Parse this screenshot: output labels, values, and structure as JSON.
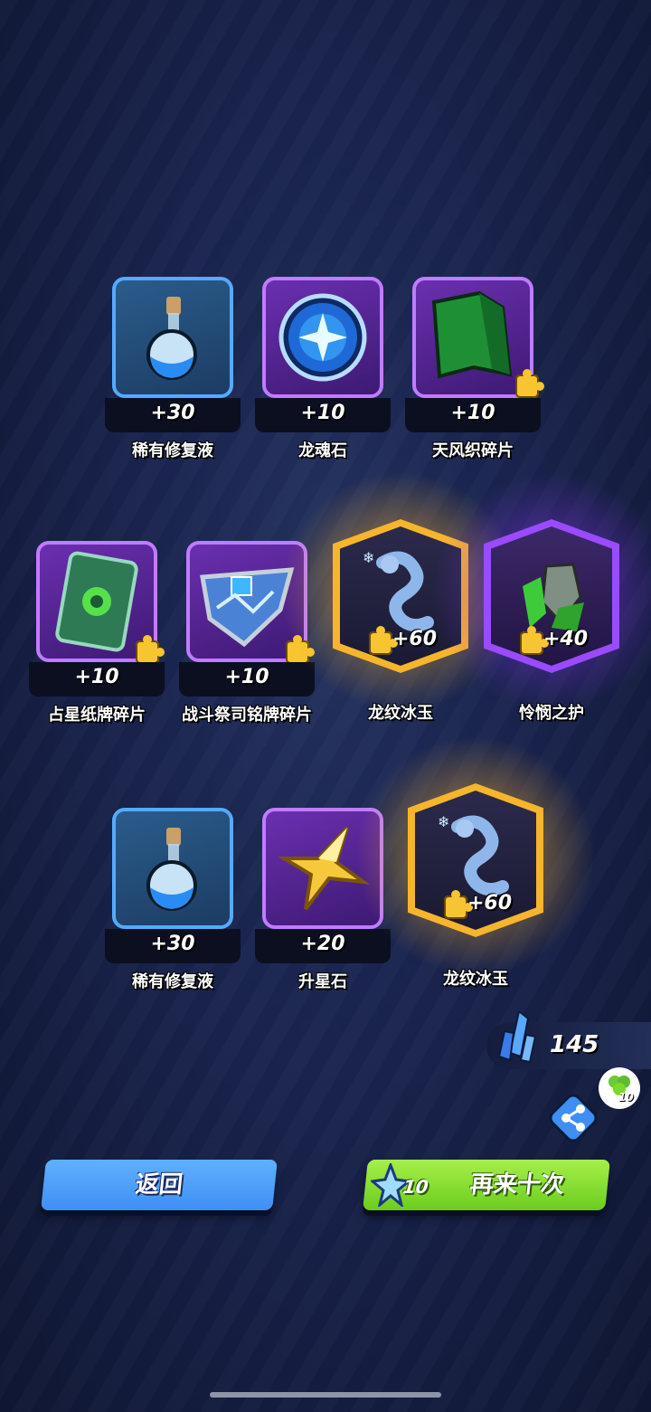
{
  "rewards": [
    {
      "name": "稀有修复液",
      "qty": "+30",
      "rarity": "blue",
      "icon": "potion-icon"
    },
    {
      "name": "龙魂石",
      "qty": "+10",
      "rarity": "purple",
      "icon": "soul-orb-icon"
    },
    {
      "name": "天风织碎片",
      "qty": "+10",
      "rarity": "purple",
      "icon": "cape-icon",
      "fragment": true
    },
    {
      "name": "占星纸牌碎片",
      "qty": "+10",
      "rarity": "purple",
      "icon": "tarot-card-icon",
      "fragment": true
    },
    {
      "name": "战斗祭司铭牌碎片",
      "qty": "+10",
      "rarity": "purple",
      "icon": "ice-badge-icon",
      "fragment": true
    },
    {
      "name": "龙纹冰玉",
      "qty": "+60",
      "rarity": "legendary-gold",
      "icon": "ice-dragon-icon",
      "fragment": true
    },
    {
      "name": "怜悯之护",
      "qty": "+40",
      "rarity": "epic-purple",
      "icon": "green-crystal-shield-icon",
      "fragment": true
    },
    {
      "name": "稀有修复液",
      "qty": "+30",
      "rarity": "blue",
      "icon": "potion-icon"
    },
    {
      "name": "升星石",
      "qty": "+20",
      "rarity": "purple",
      "icon": "gold-star-icon"
    },
    {
      "name": "龙纹冰玉",
      "qty": "+60",
      "rarity": "legendary-gold",
      "icon": "ice-dragon-icon",
      "fragment": true
    }
  ],
  "currency": {
    "value": "145",
    "icon": "blue-crystal-icon"
  },
  "share": {
    "badge": "10",
    "icon": "share-icon",
    "reward_icon": "clover-icon"
  },
  "buttons": {
    "back_label": "返回",
    "again_label": "再来十次",
    "again_cost": "10",
    "again_cost_icon": "star-crystal-icon"
  },
  "colors": {
    "blue": "#4ea2ff",
    "purple": "#a855f7",
    "gold": "#f7b52c",
    "green": "#7ad92b"
  }
}
